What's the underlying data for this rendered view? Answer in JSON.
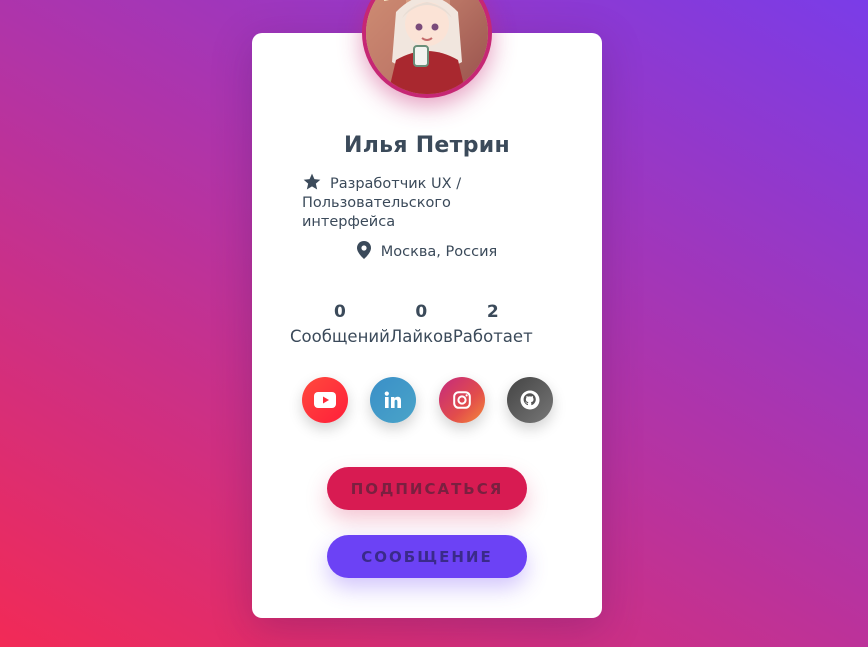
{
  "profile": {
    "name": "Илья Петрин",
    "role": "Разработчик UX / Пользовательского интерфейса",
    "location": "Москва, Россия"
  },
  "stats": [
    {
      "value": "0",
      "label": "Сообщений"
    },
    {
      "value": "0",
      "label": "Лайков"
    },
    {
      "value": "2",
      "label": "Работает"
    }
  ],
  "social": [
    {
      "icon": "youtube-icon"
    },
    {
      "icon": "linkedin-icon"
    },
    {
      "icon": "instagram-icon"
    },
    {
      "icon": "github-icon"
    }
  ],
  "actions": {
    "subscribe_label": "ПОДПИСАТЬСЯ",
    "message_label": "СООБЩЕНИЕ"
  },
  "colors": {
    "subscribe": "#d81b52",
    "message": "#6c42f5",
    "text": "#3b4a5a",
    "avatar_ring": "#c62774"
  }
}
